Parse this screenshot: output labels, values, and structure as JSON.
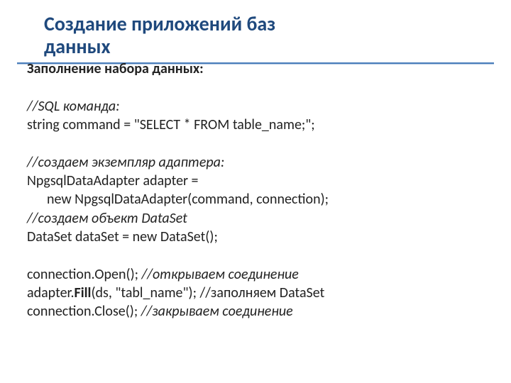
{
  "title": {
    "line1": "Создание приложений баз",
    "line2": "данных"
  },
  "lines": {
    "l0": "Заполнение набора данных:",
    "l1": "//SQL команда:",
    "l2": "string  command = \"SELECT  * FROM  table_name;\";",
    "l3": "//создаем экземпляр адаптера:",
    "l4": "NpgsqlDataAdapter adapter =",
    "l5": "new NpgsqlDataAdapter(command, connection);",
    "l6": "//создаем объект DataSet",
    "l7": "DataSet  dataSet = new DataSet();",
    "l8a": "connection.Open();     ",
    "l8b": "//открываем соединение",
    "l9a": "adapter.",
    "l9b": "Fill",
    "l9c": "(ds, \"tabl_name\");  ",
    "l9d": "//заполняем DataSet",
    "l10a": "connection.Close();     ",
    "l10b": "//закрываем соединение"
  }
}
